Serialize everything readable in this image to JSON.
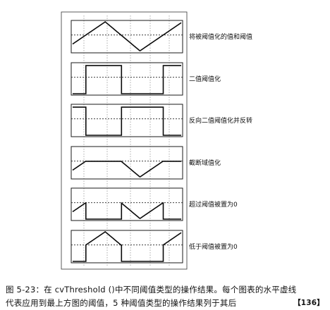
{
  "panels": [
    {
      "label": "将被阈值化的值和阈值",
      "curve": "source"
    },
    {
      "label": "二值阈值化",
      "curve": "binary"
    },
    {
      "label": "反向二值阈值化并反转",
      "curve": "binary_inv"
    },
    {
      "label": "截断域值化",
      "curve": "trunc"
    },
    {
      "label": "超过阈值被置为0",
      "curve": "tozero_inv"
    },
    {
      "label": "低于阈值被置为0",
      "curve": "tozero"
    }
  ],
  "caption": {
    "line1": "图 5-23：在 cvThreshold ()中不同阈值类型的操作结果。每个图表的水平虚线",
    "line2": "代表应用到最上方图的阈值，5 种阈值类型的操作结果列于其后",
    "page_number": "【136】"
  }
}
